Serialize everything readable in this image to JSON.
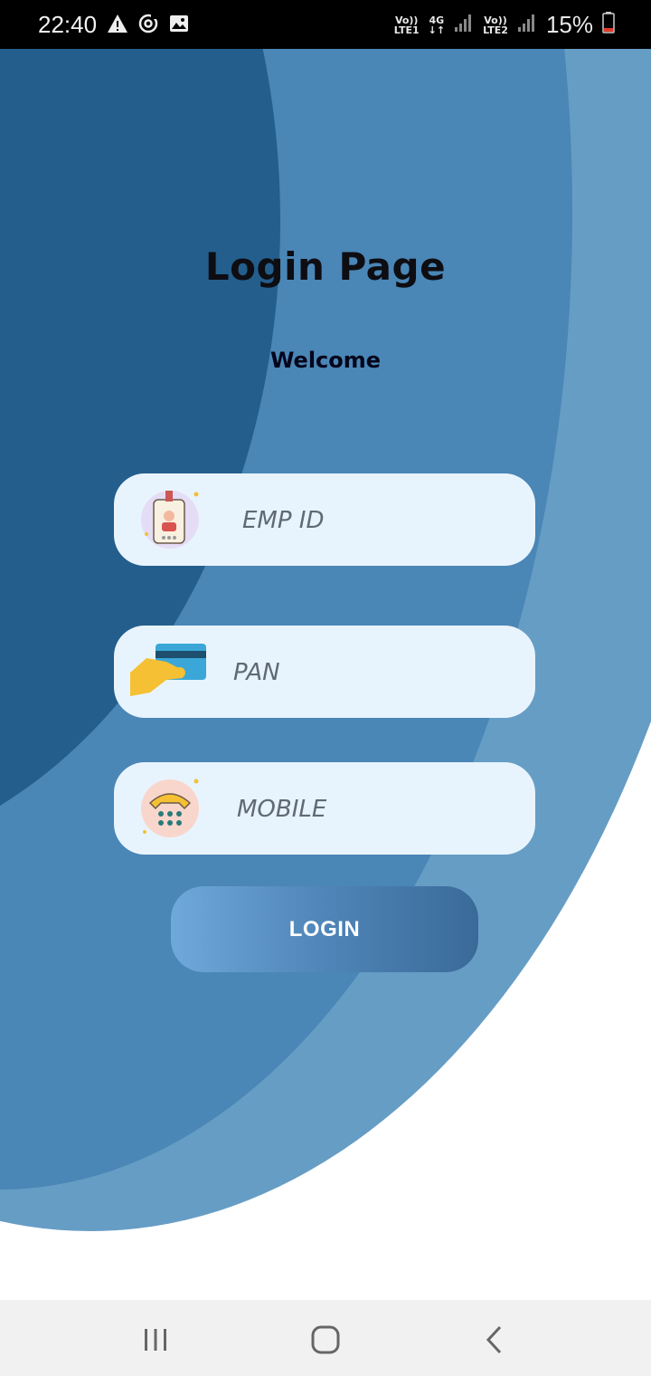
{
  "status_bar": {
    "time": "22:40",
    "net1_top": "Vo))",
    "net1_bottom": "LTE1",
    "net2_top": "4G",
    "net2_bottom": "↓↑",
    "net3_top": "Vo))",
    "net3_bottom": "LTE2",
    "battery": "15%",
    "icons": [
      "warning-icon",
      "sync-icon",
      "gallery-icon",
      "signal-icon",
      "battery-icon"
    ]
  },
  "page": {
    "title": "Login Page",
    "subtitle": "Welcome"
  },
  "form": {
    "emp_id": {
      "placeholder": "EMP ID",
      "value": "",
      "icon": "id-badge-icon"
    },
    "pan": {
      "placeholder": "PAN",
      "value": "",
      "icon": "card-in-hand-icon"
    },
    "mobile": {
      "placeholder": "MOBILE",
      "value": "",
      "icon": "telephone-icon"
    },
    "login_label": "LOGIN"
  },
  "nav": {
    "icons": [
      "recents-icon",
      "home-icon",
      "back-icon"
    ]
  },
  "colors": {
    "dark_blue": "#245e8c",
    "mid_blue": "#4a86b6",
    "light_blue": "#669dc5",
    "field_bg": "#e8f4fd"
  }
}
